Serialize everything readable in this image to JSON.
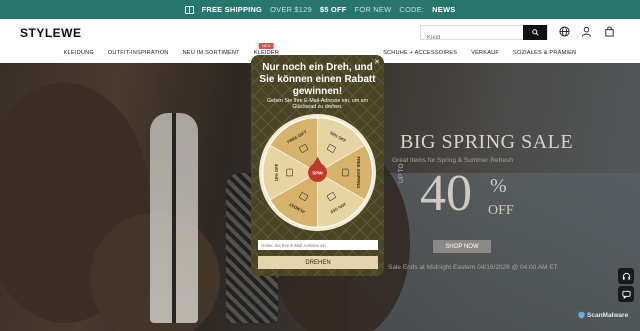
{
  "promo": {
    "free_shipping": "FREE SHIPPING",
    "over": "OVER $129",
    "discount": "$5 OFF",
    "for_new": "FOR NEW",
    "code_label": "CODE:",
    "code": "NEWS"
  },
  "header": {
    "logo": "STYLEWE",
    "search_placeholder": "Kleid",
    "icons": [
      "search-icon",
      "globe-icon",
      "user-icon",
      "bag-icon"
    ]
  },
  "nav": {
    "items": [
      {
        "label": "KLEIDUNG"
      },
      {
        "label": "OUTFIT-INSPIRATION"
      },
      {
        "label": "NEU IM SORTIMENT"
      },
      {
        "label": "KLEIDER",
        "badge": "NEU"
      },
      {
        "label": "SCHUHE + ACCESSOIRES"
      },
      {
        "label": "VERKAUF"
      },
      {
        "label": "SOZIALES & PRÄMIEN"
      }
    ]
  },
  "hero": {
    "title": "BIG SPRING SALE",
    "subtitle": "Great Items for Spring & Summer Refresh",
    "up_to": "UP TO",
    "amount": "40",
    "percent": "%",
    "off": "OFF",
    "cta": "SHOP NOW",
    "ends": "Sale Ends at Midnight Eastern 04/16/2026 @ 04:00 AM ET"
  },
  "modal": {
    "title": "Nur noch ein Dreh, und Sie können einen Rabatt gewinnen!",
    "subtitle": "Geben Sie Ihre E-Mail-Adresse ein, um am Glücksrad zu drehen.",
    "email_placeholder": "Geben Sie Ihre E-Mail-Adresse ein",
    "spin_label": "DREHEN",
    "center_label": "SPIN",
    "segments": [
      {
        "label": "50% OFF",
        "color": "#e8d4a2",
        "icon": "tag-icon"
      },
      {
        "label": "FREE SHIPPING",
        "color": "#d6b26b",
        "icon": "truck-icon"
      },
      {
        "label": "10% OFF",
        "color": "#e8d4a2",
        "icon": "ticket-icon"
      },
      {
        "label": "ALMOST",
        "color": "#d6b26b",
        "icon": "cry-face-icon"
      },
      {
        "label": "15% OFF",
        "color": "#e8d4a2",
        "icon": "coupon-icon"
      },
      {
        "label": "FREE GIFT",
        "color": "#d6b26b",
        "icon": "gift-icon"
      }
    ]
  },
  "badge_text": "ScanMalware",
  "colors": {
    "promo_bg": "#27776f",
    "modal_bg": "#4a4426",
    "spin_center": "#c0392b",
    "wheel_light": "#e8d4a2",
    "wheel_dark": "#d6b26b"
  }
}
